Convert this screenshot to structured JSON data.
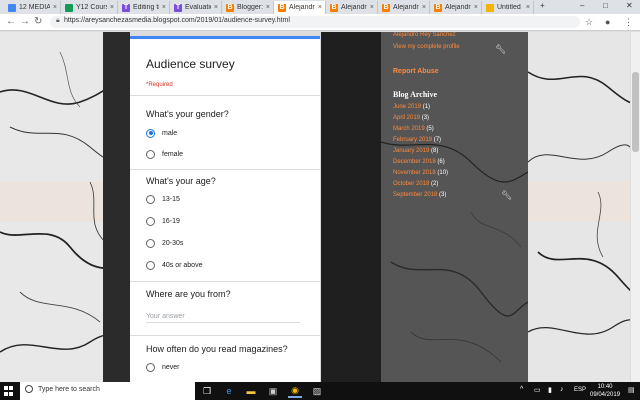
{
  "browser": {
    "tabs": [
      {
        "label": "12 MEDIA",
        "icon": "gdocs-icon",
        "color": "#4285f4"
      },
      {
        "label": "Y12 Cours",
        "icon": "gsheets-icon",
        "color": "#0f9d58"
      },
      {
        "label": "Editing ti",
        "icon": "tumblr-like-icon",
        "color": "#7b4fd9"
      },
      {
        "label": "Evaluation",
        "icon": "tumblr-like-icon",
        "color": "#7b4fd9"
      },
      {
        "label": "Blogger: Al",
        "icon": "blogger-icon",
        "color": "#f57d00"
      },
      {
        "label": "Alejandro",
        "icon": "blogger-icon",
        "color": "#f57d00"
      },
      {
        "label": "Alejandro",
        "icon": "blogger-icon",
        "color": "#f57d00"
      },
      {
        "label": "Alejandro",
        "icon": "blogger-icon",
        "color": "#f57d00"
      },
      {
        "label": "Alejandro",
        "icon": "blogger-icon",
        "color": "#f57d00"
      },
      {
        "label": "Untitled p",
        "icon": "gslides-icon",
        "color": "#f4b400"
      }
    ],
    "url": "https://areysanchezasmedia.blogspot.com/2019/01/audience-survey.html"
  },
  "form": {
    "title": "Audience survey",
    "required_note": "*Required",
    "q1": {
      "label": "What's your gender?",
      "options": [
        "male",
        "female"
      ],
      "selected": "male"
    },
    "q2": {
      "label": "What's your age?",
      "options": [
        "13-15",
        "16-19",
        "20-30s",
        "40s or above"
      ]
    },
    "q3": {
      "label": "Where are you from?",
      "placeholder": "Your answer"
    },
    "q4": {
      "label": "How often do you read magazines?",
      "options": [
        "never"
      ]
    }
  },
  "sidebar": {
    "profile_name": "Alejandro Rey Sanchez",
    "profile_link": "View my complete profile",
    "report_abuse": "Report Abuse",
    "archive_title": "Blog Archive",
    "archive": [
      {
        "label": "June 2019",
        "count": "(1)"
      },
      {
        "label": "April 2019",
        "count": "(3)"
      },
      {
        "label": "March 2019",
        "count": "(5)"
      },
      {
        "label": "February 2019",
        "count": "(7)"
      },
      {
        "label": "January 2019",
        "count": "(8)"
      },
      {
        "label": "December 2018",
        "count": "(6)"
      },
      {
        "label": "November 2018",
        "count": "(10)"
      },
      {
        "label": "October 2018",
        "count": "(2)"
      },
      {
        "label": "September 2018",
        "count": "(3)"
      }
    ]
  },
  "taskbar": {
    "search_placeholder": "Type here to search",
    "language": "ESP",
    "time": "10:40",
    "date": "09/04/2019"
  },
  "colors": {
    "accent_blue": "#1a73e8",
    "link_orange": "#ff8a3d",
    "required_red": "#d93025"
  }
}
